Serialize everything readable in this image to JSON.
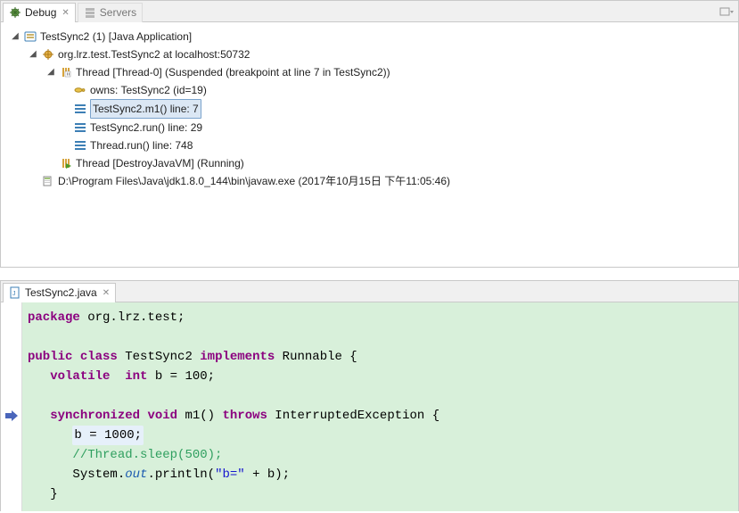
{
  "tabs": {
    "debug": {
      "label": "Debug"
    },
    "servers": {
      "label": "Servers"
    }
  },
  "debug_tree": {
    "launch": "TestSync2 (1) [Java Application]",
    "target": "org.lrz.test.TestSync2 at localhost:50732",
    "thread0": "Thread [Thread-0] (Suspended (breakpoint at line 7 in TestSync2))",
    "owns": "owns: TestSync2  (id=19)",
    "frame0": "TestSync2.m1() line: 7",
    "frame1": "TestSync2.run() line: 29",
    "frame2": "Thread.run() line: 748",
    "thread1": "Thread [DestroyJavaVM] (Running)",
    "proc": "D:\\Program Files\\Java\\jdk1.8.0_144\\bin\\javaw.exe (2017年10月15日 下午11:05:46)"
  },
  "editor_tab": "TestSync2.java",
  "code": {
    "pkg_kw": "package",
    "pkg_rest": " org.lrz.test;",
    "pub": "public",
    "cls_kw": "class",
    "cls_name": " TestSync2 ",
    "impl": "implements",
    "runnable": " Runnable {",
    "vol": "volatile",
    "intkw": "  int",
    "bdecl_rest": " b = 100;",
    "sync": "synchronized",
    "voidkw": "void",
    "m1": " m1() ",
    "throws": "throws",
    "ie": " InterruptedException {",
    "assign": "b = 1000;",
    "comment": "//Thread.sleep(500);",
    "sys": "System.",
    "out": "out",
    "println_pre": ".println(",
    "strlit": "\"b=\"",
    "println_post": " + b);",
    "brace": "}"
  }
}
